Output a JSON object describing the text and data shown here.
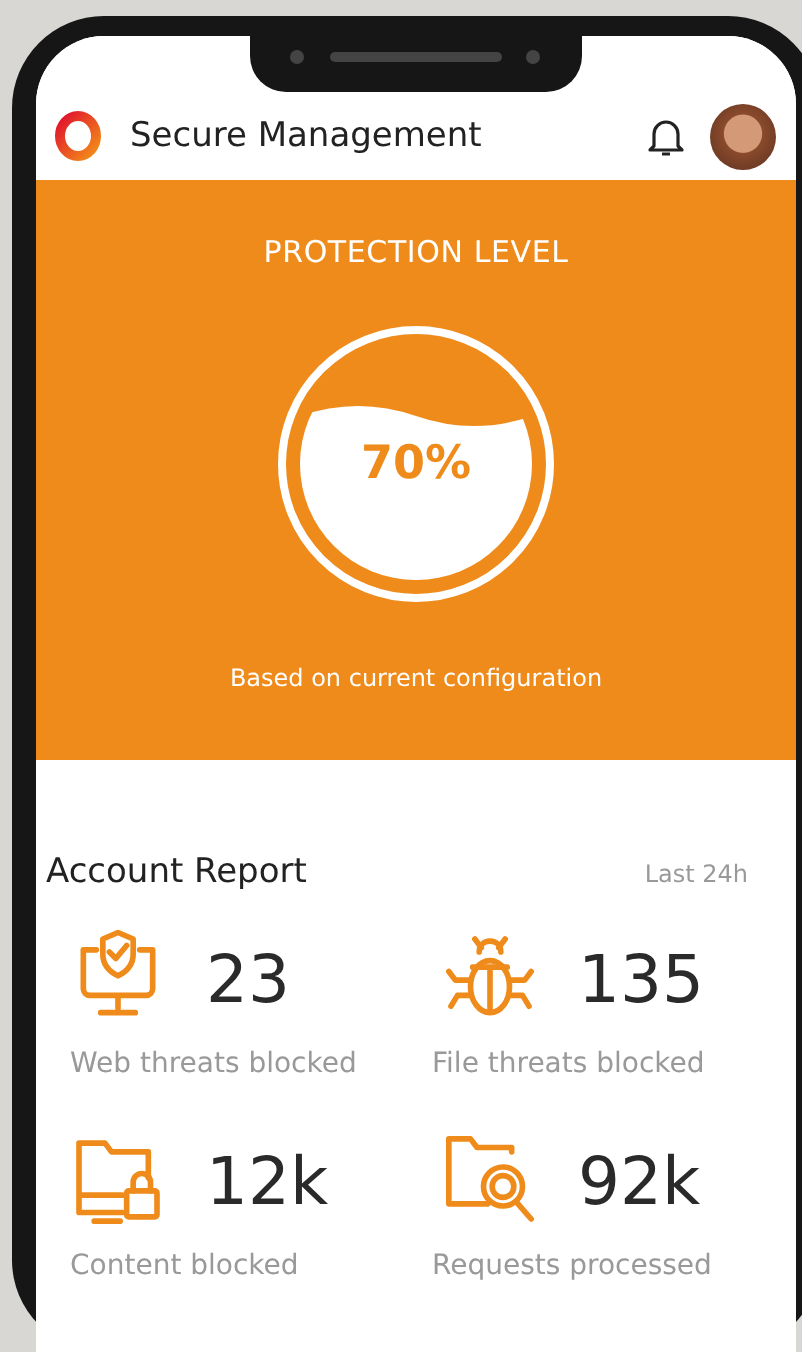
{
  "header": {
    "title": "Secure Management"
  },
  "protection": {
    "title": "PROTECTION LEVEL",
    "reading": "70%",
    "caption": "Based on current configuration"
  },
  "report": {
    "title": "Account Report",
    "period": "Last 24h",
    "stats": [
      {
        "kind": "web",
        "value": "23",
        "label": "Web threats blocked"
      },
      {
        "kind": "file",
        "value": "135",
        "label": "File threats blocked"
      },
      {
        "kind": "content",
        "value": "12k",
        "label": "Content blocked"
      },
      {
        "kind": "requests",
        "value": "92k",
        "label": "Requests processed"
      }
    ]
  }
}
